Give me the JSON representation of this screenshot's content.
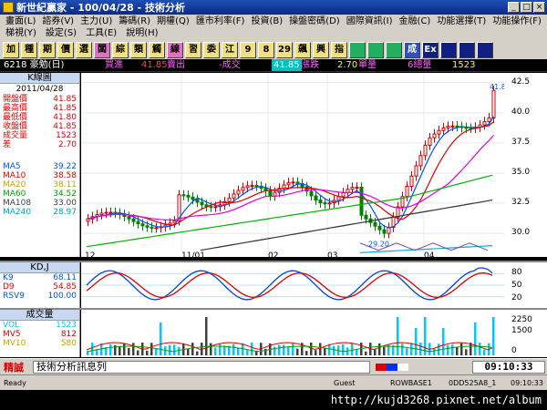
{
  "window": {
    "title": "新世紀贏家 - 100/04/28 - 技術分析"
  },
  "menu": {
    "row1": [
      "畫面(L)",
      "諮券(V)",
      "主力(U)",
      "籌碼(R)",
      "期權(Q)",
      "匯市利率(F)",
      "投資(B)",
      "操盤密碼(D)",
      "國際資訊(I)",
      "金融(C)",
      "功能選擇(T)",
      "功能操作(F)"
    ],
    "row2": [
      "梯視(Y)",
      "設定(S)",
      "工具(E)",
      "說明(H)"
    ]
  },
  "toolbar": {
    "buttons": [
      "加",
      "種",
      "期",
      "價",
      "選",
      "闆",
      "綜",
      "類",
      "觸",
      "線",
      "習",
      "委",
      "江",
      "9",
      "8",
      "29",
      "飆",
      "興",
      "指",
      "",
      "",
      "",
      "成",
      "Ex",
      "",
      "",
      ""
    ]
  },
  "infobar": {
    "symbol": "6218 豪勉(日)",
    "buy_label": "買進",
    "buy_value": "41.85",
    "sell_label": "賣出",
    "change_label": "-成交",
    "last_value": "41.85",
    "diff_label": "漲跌",
    "diff_value": "2.70",
    "unit_label": "單量",
    "vol_label": "6總量",
    "vol_value": "1523"
  },
  "leftpanel": {
    "head": "K線圖",
    "date": "2011/04/28",
    "rows": [
      {
        "label": "開盤價",
        "value": "41.85",
        "color": "#d00"
      },
      {
        "label": "最高價",
        "value": "41.85",
        "color": "#d00"
      },
      {
        "label": "最低價",
        "value": "41.80",
        "color": "#d00"
      },
      {
        "label": "收盤價",
        "value": "41.85",
        "color": "#d00"
      },
      {
        "label": "成交量",
        "value": "1523",
        "color": "#d00"
      },
      {
        "label": "差",
        "value": "2.70",
        "color": "#d00"
      }
    ],
    "ma_rows": [
      {
        "label": "MA5",
        "value": "39.22",
        "color": "#0050ff"
      },
      {
        "label": "MA10",
        "value": "38.58",
        "color": "#d00"
      },
      {
        "label": "MA20",
        "value": "38.11",
        "color": "#d0a000"
      },
      {
        "label": "MA60",
        "value": "34.52",
        "color": "#00a000"
      },
      {
        "label": "MA108",
        "value": "33.00",
        "color": "#404040"
      },
      {
        "label": "MA240",
        "value": "28.97",
        "color": "#00a0c0"
      }
    ]
  },
  "chart_data": [
    {
      "type": "candlestick",
      "ylim": [
        28.5,
        43
      ],
      "yticks": [
        "42.5",
        "40.0",
        "37.5",
        "35.0",
        "32.5",
        "30.0"
      ],
      "xticks": [
        "12",
        "11/01",
        "02",
        "03",
        "04"
      ],
      "annotations": [
        "41.85",
        "29.20"
      ]
    },
    {
      "type": "line",
      "title": "KD,J",
      "yticks": [
        "80",
        "50",
        "20"
      ],
      "series": [
        {
          "name": "K9",
          "value": "68.11",
          "color": "#0050ff"
        },
        {
          "name": "D9",
          "value": "54.85",
          "color": "#d00"
        },
        {
          "name": "RSV9",
          "value": "100.00",
          "color": "#0050ff"
        }
      ]
    },
    {
      "type": "bar",
      "title": "成交量",
      "yticks": [
        "2250",
        "1500",
        "0"
      ],
      "series": [
        {
          "name": "VOL",
          "value": "1523",
          "color": "#00c8ff"
        },
        {
          "name": "MV5",
          "value": "812",
          "color": "#d00"
        },
        {
          "name": "MV10",
          "value": "580",
          "color": "#d0a000"
        }
      ]
    }
  ],
  "bottombar": {
    "brand": "精誠",
    "message": "技術分析訊息列",
    "clock": "09:10:33"
  },
  "statusbar": {
    "ready": "Ready",
    "guest": "Guest",
    "host": "ROWBASE1",
    "code": "0DD525A8_1",
    "time": "09:10:33"
  },
  "url": "http://kujd3268.pixnet.net/album"
}
